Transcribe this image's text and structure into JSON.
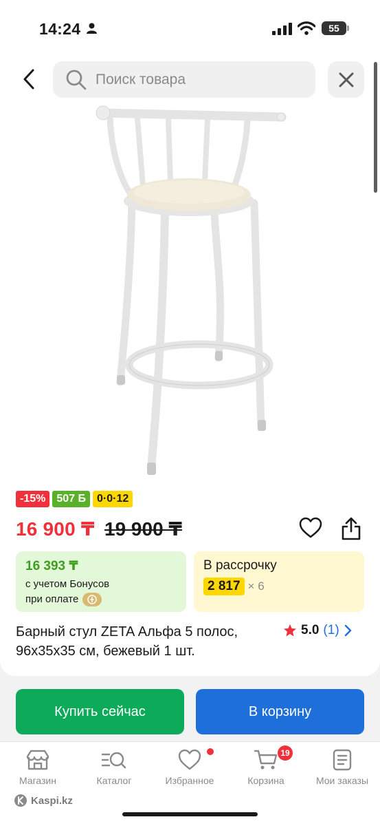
{
  "status_bar": {
    "time": "14:24",
    "battery": "55"
  },
  "search": {
    "placeholder": "Поиск товара"
  },
  "badges": {
    "discount": "-15%",
    "bonus": "507 Б",
    "installment": "0·0·12"
  },
  "price": {
    "current": "16 900 ₸",
    "old": "19 900 ₸"
  },
  "bonus_offer": {
    "amount": "16 393 ₸",
    "line1": "с учетом Бонусов",
    "line2": "при оплате"
  },
  "installment_offer": {
    "title": "В рассрочку",
    "monthly": "2 817",
    "months": "× 6"
  },
  "product": {
    "title": "Барный стул ZETA Альфа 5 полос, 96x35x35 см, бежевый 1 шт."
  },
  "rating": {
    "score": "5.0",
    "count": "(1)"
  },
  "actions": {
    "buy_now": "Купить сейчас",
    "add_to_cart": "В корзину"
  },
  "nav": {
    "items": [
      {
        "label": "Магазин",
        "icon": "store-icon"
      },
      {
        "label": "Каталог",
        "icon": "catalog-search-icon"
      },
      {
        "label": "Избранное",
        "icon": "heart-icon"
      },
      {
        "label": "Корзина",
        "icon": "cart-icon",
        "badge": "19"
      },
      {
        "label": "Мои заказы",
        "icon": "orders-icon"
      }
    ]
  },
  "brand": {
    "name": "Kaspi.kz"
  },
  "colors": {
    "discount": "#f0303a",
    "bonus": "#5ab029",
    "installment": "#ffd700",
    "buy_now": "#0daa5a",
    "add_to_cart": "#1e6fd9",
    "link": "#1e6fe0"
  }
}
